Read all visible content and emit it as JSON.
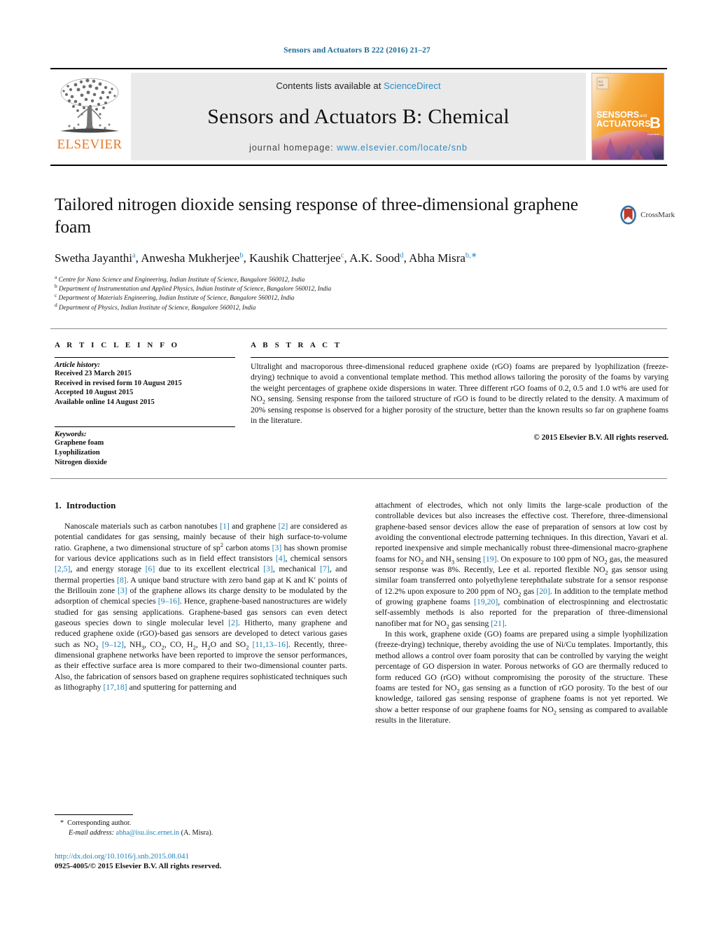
{
  "running_head": "Sensors and Actuators B 222 (2016) 21–27",
  "masthead": {
    "publisher_logo_word": "ELSEVIER",
    "contents_prefix": "Contents lists available at ",
    "contents_link": "ScienceDirect",
    "journal_name": "Sensors and Actuators B: Chemical",
    "homepage_prefix": "journal homepage: ",
    "homepage_url": "www.elsevier.com/locate/snb",
    "cover": {
      "line1": "SENSORS",
      "line1_small": "and",
      "line2": "ACTUATORS",
      "letter": "B",
      "letter_sub": "Chemical"
    }
  },
  "article": {
    "title": "Tailored nitrogen dioxide sensing response of three-dimensional graphene foam",
    "crossmark_label": "CrossMark",
    "authors": [
      {
        "name": "Swetha Jayanthi",
        "marks": "a"
      },
      {
        "name": "Anwesha Mukherjee",
        "marks": "b"
      },
      {
        "name": "Kaushik Chatterjee",
        "marks": "c"
      },
      {
        "name": "A.K. Sood",
        "marks": "d"
      },
      {
        "name": "Abha Misra",
        "marks": "b,∗"
      }
    ],
    "affiliations": [
      {
        "mark": "a",
        "text": "Centre for Nano Science and Engineering, Indian Institute of Science, Bangalore 560012, India"
      },
      {
        "mark": "b",
        "text": "Department of Instrumentation and Applied Physics, Indian Institute of Science, Bangalore 560012, India"
      },
      {
        "mark": "c",
        "text": "Department of Materials Engineering, Indian Institute of Science, Bangalore 560012, India"
      },
      {
        "mark": "d",
        "text": "Department of Physics, Indian Institute of Science, Bangalore 560012, India"
      }
    ]
  },
  "article_info": {
    "heading": "A R T I C L E   I N F O",
    "history_label": "Article history:",
    "history": [
      "Received 23 March 2015",
      "Received in revised form 10 August 2015",
      "Accepted 10 August 2015",
      "Available online 14 August 2015"
    ],
    "keywords_label": "Keywords:",
    "keywords": [
      "Graphene foam",
      "Lyophilization",
      "Nitrogen dioxide"
    ]
  },
  "abstract": {
    "heading": "A B S T R A C T",
    "text": "Ultralight and macroporous three-dimensional reduced graphene oxide (rGO) foams are prepared by lyophilization (freeze-drying) technique to avoid a conventional template method. This method allows tailoring the porosity of the foams by varying the weight percentages of graphene oxide dispersions in water. Three different rGO foams of 0.2, 0.5 and 1.0 wt% are used for NO2 sensing. Sensing response from the tailored structure of rGO is found to be directly related to the density. A maximum of 20% sensing response is observed for a higher porosity of the structure, better than the known results so far on graphene foams in the literature.",
    "copyright": "© 2015 Elsevier B.V. All rights reserved."
  },
  "introduction": {
    "number": "1.",
    "heading": "Introduction",
    "left_paragraph": "Nanoscale materials such as carbon nanotubes [1] and graphene [2] are considered as potential candidates for gas sensing, mainly because of their high surface-to-volume ratio. Graphene, a two dimensional structure of sp2 carbon atoms [3] has shown promise for various device applications such as in field effect transistors [4], chemical sensors [2,5], and energy storage [6] due to its excellent electrical [3], mechanical [7], and thermal properties [8]. A unique band structure with zero band gap at K and K′ points of the Brillouin zone [3] of the graphene allows its charge density to be modulated by the adsorption of chemical species [9–16]. Hence, graphene-based nanostructures are widely studied for gas sensing applications. Graphene-based gas sensors can even detect gaseous species down to single molecular level [2]. Hitherto, many graphene and reduced graphene oxide (rGO)-based gas sensors are developed to detect various gases such as NO2 [9–12], NH3, CO2, CO, H2, H2O and SO2 [11,13–16]. Recently, three-dimensional graphene networks have been reported to improve the sensor performances, as their effective surface area is more compared to their two-dimensional counter parts. Also, the fabrication of sensors based on graphene requires sophisticated techniques such as lithography [17,18] and sputtering for patterning and",
    "right_paragraph_1": "attachment of electrodes, which not only limits the large-scale production of the controllable devices but also increases the effective cost. Therefore, three-dimensional graphene-based sensor devices allow the ease of preparation of sensors at low cost by avoiding the conventional electrode patterning techniques. In this direction, Yavari et al. reported inexpensive and simple mechanically robust three-dimensional macro-graphene foams for NO2 and NH3 sensing [19]. On exposure to 100 ppm of NO2 gas, the measured sensor response was 8%. Recently, Lee et al. reported flexible NO2 gas sensor using similar foam transferred onto polyethylene terephthalate substrate for a sensor response of 12.2% upon exposure to 200 ppm of NO2 gas [20]. In addition to the template method of growing graphene foams [19,20], combination of electrospinning and electrostatic self-assembly methods is also reported for the preparation of three-dimensional nanofiber mat for NO2 gas sensing [21].",
    "right_paragraph_2": "In this work, graphene oxide (GO) foams are prepared using a simple lyophilization (freeze-drying) technique, thereby avoiding the use of Ni/Cu templates. Importantly, this method allows a control over foam porosity that can be controlled by varying the weight percentage of GO dispersion in water. Porous networks of GO are thermally reduced to form reduced GO (rGO) without compromising the porosity of the structure. These foams are tested for NO2 gas sensing as a function of rGO porosity. To the best of our knowledge, tailored gas sensing response of graphene foams is not yet reported. We show a better response of our graphene foams for NO2 sensing as compared to available results in the literature."
  },
  "footer": {
    "corresponding_star": "*",
    "corresponding_text": "Corresponding author.",
    "email_label": "E-mail address:",
    "email": "abha@isu.iisc.ernet.in",
    "email_suffix": "(A. Misra).",
    "doi": "http://dx.doi.org/10.1016/j.snb.2015.08.041",
    "issn": "0925-4005/© 2015 Elsevier B.V. All rights reserved."
  },
  "colors": {
    "link_blue": "#1b7fb5",
    "header_blue": "#1b6a96",
    "sciencedirect_blue": "#2a8bc4",
    "elsevier_orange": "#E87722",
    "band_gray": "#eaeaea"
  }
}
